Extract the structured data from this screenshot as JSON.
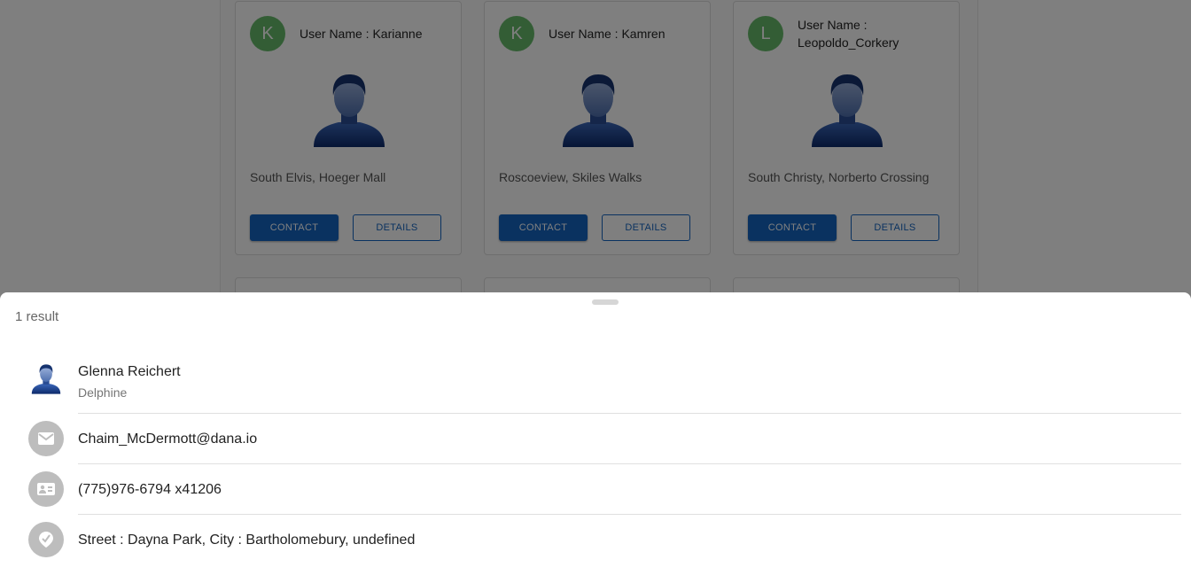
{
  "cards": [
    {
      "initial": "K",
      "user_name": "User Name : Karianne",
      "location": "South Elvis, Hoeger Mall",
      "contact_label": "CONTACT",
      "details_label": "DETAILS"
    },
    {
      "initial": "K",
      "user_name": "User Name : Kamren",
      "location": "Roscoeview, Skiles Walks",
      "contact_label": "CONTACT",
      "details_label": "DETAILS"
    },
    {
      "initial": "L",
      "user_name": "User Name : Leopoldo_Corkery",
      "location": "South Christy, Norberto Crossing",
      "contact_label": "CONTACT",
      "details_label": "DETAILS"
    }
  ],
  "sheet": {
    "result_count": "1 result",
    "person": {
      "name": "Glenna Reichert",
      "username": "Delphine"
    },
    "email": "Chaim_McDermott@dana.io",
    "phone": "(775)976-6794 x41206",
    "address": "Street : Dayna Park, City : Bartholomebury, undefined",
    "icons": {
      "email": "email-icon",
      "phone": "contact-card-icon",
      "address": "location-pin-icon"
    }
  },
  "colors": {
    "avatar_green": "#66bb6a",
    "primary_blue": "#1565c0"
  }
}
